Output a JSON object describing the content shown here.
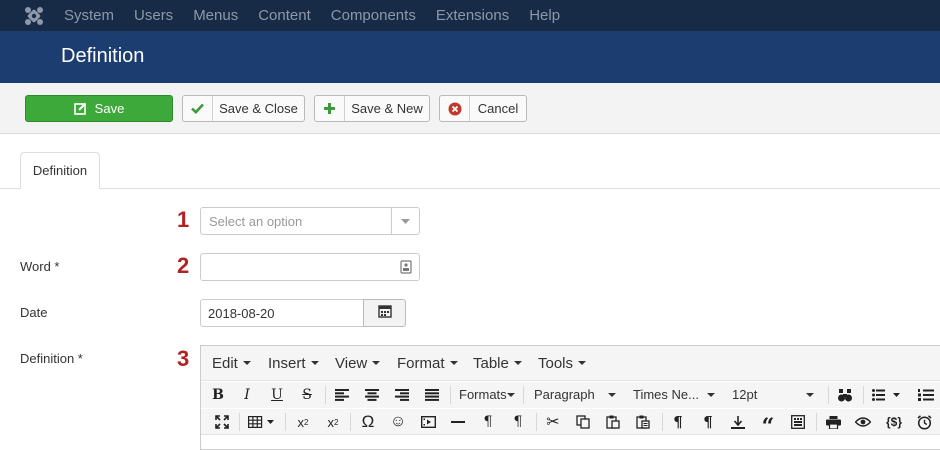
{
  "topnav": {
    "items": [
      "System",
      "Users",
      "Menus",
      "Content",
      "Components",
      "Extensions",
      "Help"
    ]
  },
  "header": {
    "title": "Definition"
  },
  "toolbar": {
    "save_label": "Save",
    "save_close_label": "Save & Close",
    "save_new_label": "Save & New",
    "cancel_label": "Cancel"
  },
  "tabs": [
    {
      "label": "Definition"
    }
  ],
  "markers": [
    "1",
    "2",
    "3"
  ],
  "form": {
    "select": {
      "placeholder": "Select an option"
    },
    "word": {
      "label": "Word *",
      "value": ""
    },
    "date": {
      "label": "Date",
      "value": "2018-08-20"
    },
    "definition": {
      "label": "Definition *"
    }
  },
  "editor": {
    "menubar": [
      "Edit",
      "Insert",
      "View",
      "Format",
      "Table",
      "Tools"
    ],
    "formats_label": "Formats",
    "block_format": "Paragraph",
    "font_family": "Times Ne...",
    "font_size": "12pt"
  },
  "colors": {
    "topnav_bg": "#172a46",
    "header_bg": "#1c3d6f",
    "save_green": "#3da93a",
    "marker_red": "#b22222"
  }
}
